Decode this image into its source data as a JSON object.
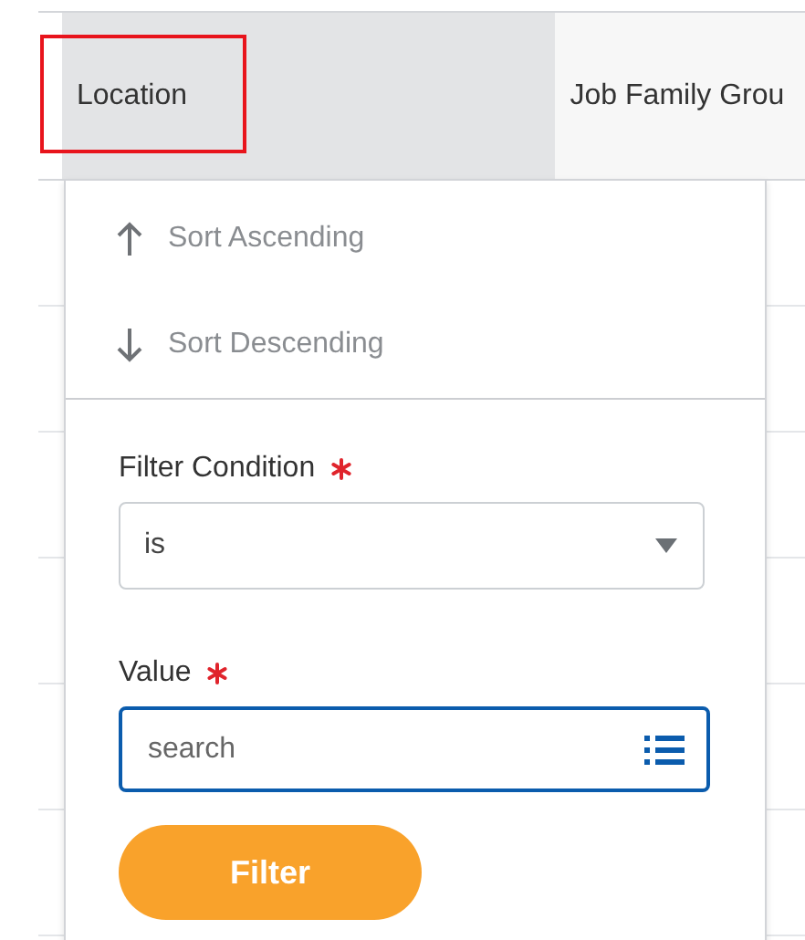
{
  "columns": [
    {
      "label": "Location",
      "selected": true,
      "highlighted": true
    },
    {
      "label": "Job Family Grou",
      "selected": false,
      "highlighted": false
    }
  ],
  "menu": {
    "sort_options": [
      {
        "label": "Sort Ascending",
        "kind": "up"
      },
      {
        "label": "Sort Descending",
        "kind": "down"
      }
    ],
    "filter_condition": {
      "label": "Filter Condition",
      "required": true,
      "value": "is"
    },
    "value": {
      "label": "Value",
      "required": true,
      "placeholder": "search"
    },
    "button": "Filter"
  }
}
